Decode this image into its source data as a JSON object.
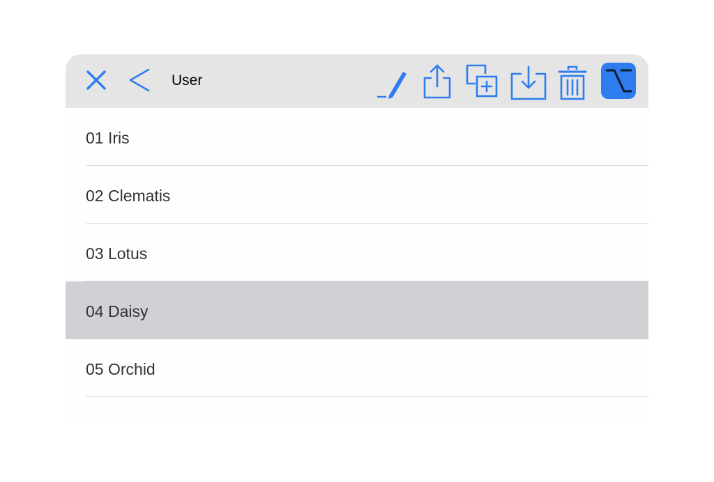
{
  "colors": {
    "accent": "#2f7cf0",
    "toolbar_background": "#e5e5e6",
    "selected_row_background": "#d1d1d5",
    "divider": "#dcdcdf",
    "row_text": "#333333"
  },
  "toolbar": {
    "title": "User",
    "icons": {
      "close": "close-icon",
      "back": "chevron-left-icon",
      "edit": "pencil-icon",
      "export": "share-icon",
      "duplicate": "duplicate-icon",
      "import": "import-tray-icon",
      "delete": "trash-icon",
      "option": "option-key-icon"
    }
  },
  "list": {
    "selected_index": 3,
    "items": [
      {
        "label": "01 Iris"
      },
      {
        "label": "02 Clematis"
      },
      {
        "label": "03 Lotus"
      },
      {
        "label": "04 Daisy"
      },
      {
        "label": "05 Orchid"
      }
    ]
  }
}
